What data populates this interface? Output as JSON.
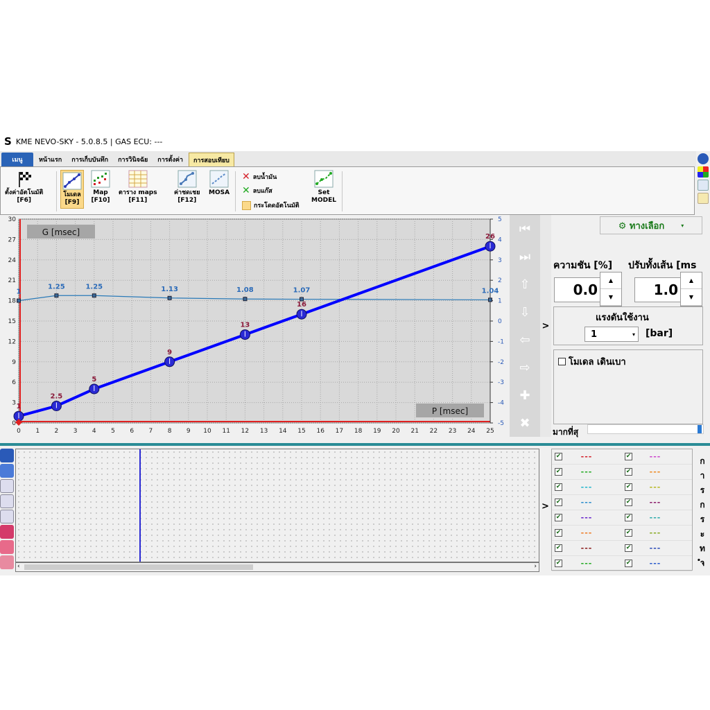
{
  "window": {
    "title": "KME NEVO-SKY - 5.0.8.5 | GAS ECU: ---",
    "logo": "S"
  },
  "tabs": [
    {
      "label": "เมนู"
    },
    {
      "label": "หน้าแรก"
    },
    {
      "label": "การเก็บบันทึก"
    },
    {
      "label": "การวินิจฉัย"
    },
    {
      "label": "การตั้งค่า"
    },
    {
      "label": "การสอบเทียบ"
    }
  ],
  "ribbon": {
    "autocal": "ตั้งค่าอัตโนมัติ",
    "autocal_key": "[F6]",
    "model": "โมเดล",
    "model_key": "[F9]",
    "map": "Map",
    "map_key": "[F10]",
    "maptable": "ตาราง maps",
    "maptable_key": "[F11]",
    "correction": "ค่าชดเชย",
    "correction_key": "[F12]",
    "mosa": "MOSA",
    "del_fuel": "ลบน้ำมัน",
    "del_gas": "ลบแก๊ส",
    "autojump": "กระโดดอัตโนมัติ",
    "set_model": "Set",
    "set_model2": "MODEL"
  },
  "chart_data": {
    "type": "line",
    "ylabel": "G [msec]",
    "xlabel": "P [msec]",
    "x_ticks": [
      0,
      1,
      2,
      3,
      4,
      5,
      6,
      7,
      8,
      9,
      10,
      11,
      12,
      13,
      14,
      15,
      16,
      17,
      18,
      19,
      20,
      21,
      22,
      23,
      24,
      25
    ],
    "y_ticks": [
      0,
      3,
      6,
      9,
      12,
      15,
      18,
      21,
      24,
      27,
      30
    ],
    "y2_ticks": [
      -5,
      -4,
      -3,
      -2,
      -1,
      0,
      1,
      2,
      3,
      4,
      5
    ],
    "xlim": [
      0,
      25
    ],
    "ylim": [
      0,
      30
    ],
    "y2lim": [
      -5,
      5
    ],
    "series": [
      {
        "color": "#0000ff",
        "x": [
          0,
          2,
          4,
          8,
          12,
          15,
          25
        ],
        "y": [
          1,
          2.5,
          5,
          9,
          13,
          16,
          26
        ],
        "labels": [
          "1",
          "2.5",
          "5",
          "9",
          "13",
          "16",
          "26"
        ]
      },
      {
        "color": "#2a7ab8",
        "axis": "right",
        "x": [
          0,
          2,
          4,
          8,
          12,
          15,
          25
        ],
        "y": [
          1,
          1.25,
          1.25,
          1.13,
          1.08,
          1.07,
          1.04
        ],
        "labels": [
          "1",
          "1.25",
          "1.25",
          "1.13",
          "1.08",
          "1.07",
          "1.04"
        ]
      }
    ]
  },
  "nav": {
    "first": "⏮",
    "last": "⏭",
    "up": "⇧",
    "down": "⇩",
    "left": "⇦",
    "right": "⇨",
    "add": "✚",
    "remove": "✖"
  },
  "right": {
    "options": "⚙ ทางเลือก",
    "concentration": "ความชัน [%]",
    "adjust_all": "ปรับทั้งเส้น [ms",
    "conc_value": "0.0",
    "adjust_value": "1.0",
    "pressure_label": "แรงดันใช้งาน",
    "pressure_value": "1",
    "pressure_unit": "[bar]",
    "model_idle": "โมเดล เดินเบา",
    "max_label": "มากที่สุ",
    "gt": ">"
  },
  "lower": {
    "gt": ">",
    "channels": [
      {
        "c1": "#d4202a",
        "c2": "#cc44cc"
      },
      {
        "c1": "#22aa22",
        "c2": "#ee8a22"
      },
      {
        "c1": "#22b6cc",
        "c2": "#b8b822"
      },
      {
        "c1": "#2a8ccc",
        "c2": "#8a1a6a"
      },
      {
        "c1": "#6622cc",
        "c2": "#2aaaaa"
      },
      {
        "c1": "#ee7a22",
        "c2": "#88aa22"
      },
      {
        "c1": "#8a1a1a",
        "c2": "#2a4ab8"
      },
      {
        "c1": "#22aa22",
        "c2": "#2a5acc"
      }
    ],
    "vertical": [
      "ก",
      "า",
      "ร",
      "ก",
      "ร",
      "ะ",
      "ท",
      "ำ"
    ]
  }
}
